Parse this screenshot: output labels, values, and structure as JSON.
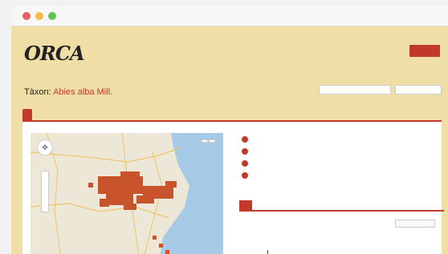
{
  "window": {
    "controls": [
      "close",
      "minimize",
      "maximize"
    ]
  },
  "header": {
    "logo": "ORCA",
    "tagline": "",
    "nav": [
      "",
      "",
      ""
    ],
    "login_label": ""
  },
  "taxon": {
    "label": "Tàxon:",
    "name": "Abies alba Mill."
  },
  "search": {
    "placeholder": "",
    "button_label": ""
  },
  "tabs": [
    "",
    ""
  ],
  "stats": [
    {
      "label": "",
      "badge": ""
    },
    {
      "label": "",
      "badge": ""
    },
    {
      "label": "",
      "badge": ""
    },
    {
      "label": "",
      "badge": ""
    }
  ],
  "subtabs": [
    "",
    ""
  ],
  "download_label": "",
  "chart": {
    "title": ""
  },
  "colors": {
    "accent": "#c0392b",
    "page_bg": "#efdfa6",
    "distribution": "#c9532d"
  }
}
